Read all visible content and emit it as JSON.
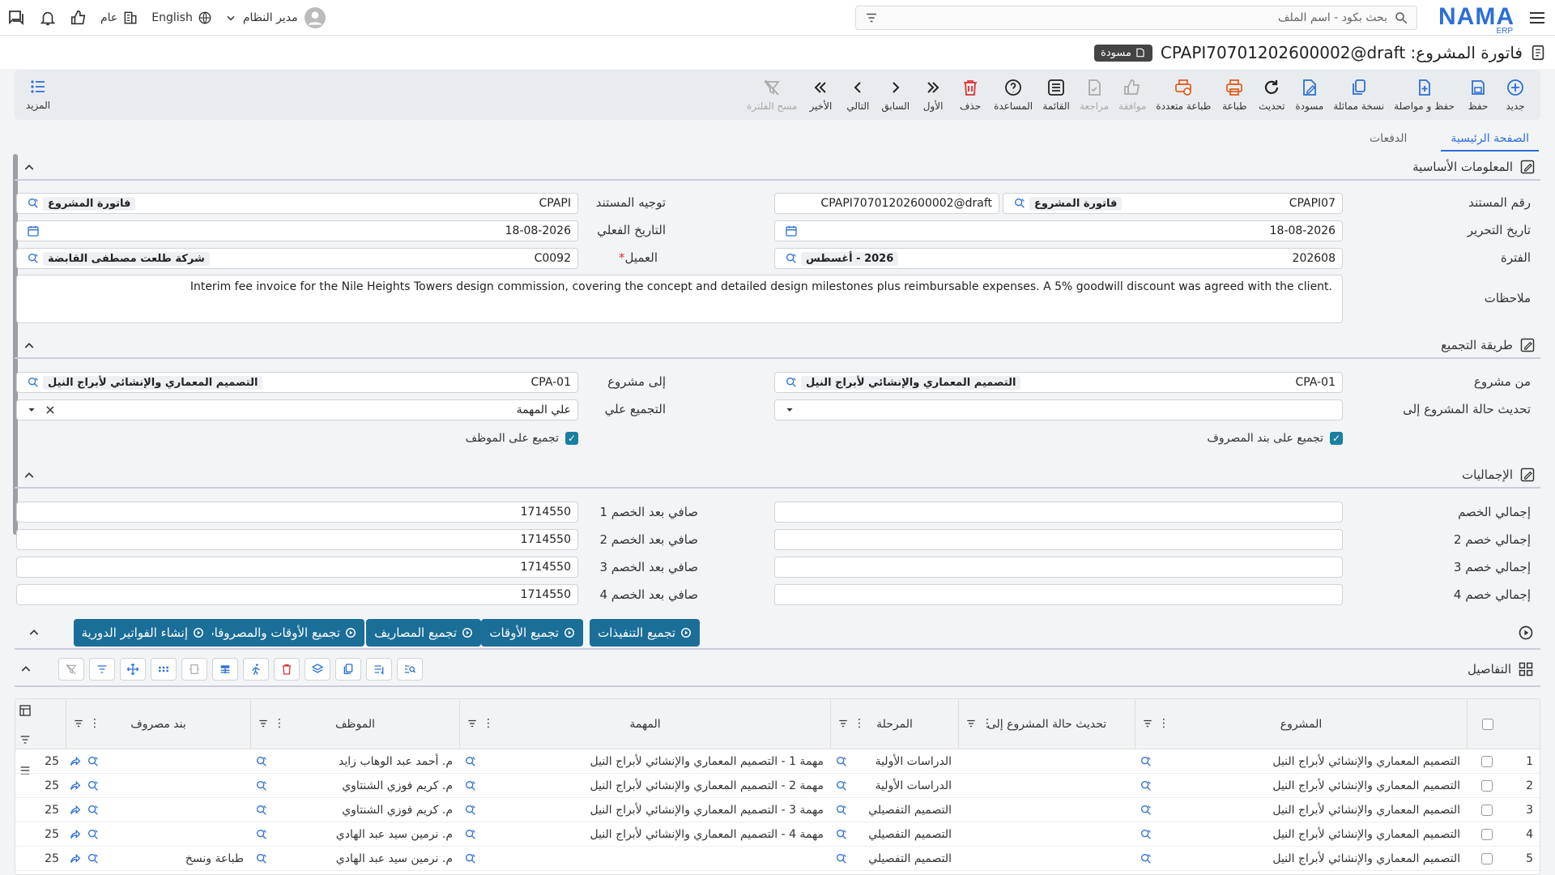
{
  "topbar": {
    "logo": "NAMA",
    "logo_sub": "ERP",
    "search_placeholder": "بحث بكود - اسم الملف",
    "user_name": "مدير النظام",
    "language": "English",
    "company": "عام"
  },
  "title": {
    "text": "فاتورة المشروع: CPAPI70701202600002@draft",
    "badge": "مسودة"
  },
  "toolbar": {
    "buttons": [
      {
        "label": "جديد",
        "icon": "plus-circle-icon"
      },
      {
        "label": "حفظ",
        "icon": "save-icon"
      },
      {
        "label": "حفظ و مواصلة",
        "icon": "save-continue-icon"
      },
      {
        "label": "نسخة مماثلة",
        "icon": "copy-icon"
      },
      {
        "label": "مسودة",
        "icon": "draft-icon"
      },
      {
        "label": "تحديث",
        "icon": "refresh-icon"
      },
      {
        "label": "طباعة",
        "icon": "print-icon"
      },
      {
        "label": "طباعة متعددة",
        "icon": "multi-print-icon"
      },
      {
        "label": "موافقة",
        "icon": "thumbs-up-icon"
      },
      {
        "label": "مراجعة",
        "icon": "review-icon"
      },
      {
        "label": "القائمة",
        "icon": "list-icon"
      },
      {
        "label": "المساعدة",
        "icon": "help-icon"
      },
      {
        "label": "حذف",
        "icon": "trash-icon"
      },
      {
        "label": "الأول",
        "icon": "first-icon"
      },
      {
        "label": "السابق",
        "icon": "prev-icon"
      },
      {
        "label": "التالي",
        "icon": "next-icon"
      },
      {
        "label": "الأخير",
        "icon": "last-icon"
      },
      {
        "label": "مسح الفلترة",
        "icon": "clear-filter-icon"
      }
    ],
    "more": "المزيد"
  },
  "tabs": [
    "الصفحة الرئيسية",
    "الدفعات"
  ],
  "basic_info": {
    "title": "المعلومات الأساسية",
    "doc_no_label": "رقم المستند",
    "doc_no_code": "CPAPI07",
    "doc_no_chip": "فاتورة المشروع",
    "doc_no_value": "CPAPI70701202600002@draft",
    "direction_label": "توجيه المستند",
    "direction_code": "CPAPI",
    "direction_chip": "فاتورة المشروع",
    "edit_date_label": "تاريخ التحرير",
    "edit_date": "18-08-2026",
    "actual_date_label": "التاريخ الفعلي",
    "actual_date": "18-08-2026",
    "period_label": "الفترة",
    "period_code": "202608",
    "period_chip": "2026 - أغسطس",
    "customer_label": "العميل",
    "customer_required": "*",
    "customer_code": "C0092",
    "customer_chip": "شركة طلعت مصطفى القابضة",
    "notes_label": "ملاحظات",
    "notes": "Interim fee invoice for the Nile Heights Towers design commission, covering the concept and detailed design milestones plus reimbursable expenses. A 5% goodwill discount was agreed with the client."
  },
  "grouping": {
    "title": "طريقة التجميع",
    "from_project_label": "من مشروع",
    "from_project_code": "CPA-01",
    "from_project_chip": "التصميم المعماري والإنشائي لأبراج النيل",
    "to_project_label": "إلى مشروع",
    "to_project_code": "CPA-01",
    "to_project_chip": "التصميم المعماري والإنشائي لأبراج النيل",
    "update_status_label": "تحديث حالة المشروع إلى",
    "group_on_label": "التجميع علي",
    "group_on_value": "علي المهمة",
    "chk_expense": "تجميع على بند المصروف",
    "chk_employee": "تجميع على الموظف"
  },
  "totals": {
    "title": "الإجماليات",
    "total_discount_label": "إجمالي الخصم",
    "total_discount2_label": "إجمالي خصم 2",
    "total_discount3_label": "إجمالي خصم 3",
    "total_discount4_label": "إجمالي خصم 4",
    "net1_label": "صافي بعد الخصم 1",
    "net2_label": "صافي بعد الخصم 2",
    "net3_label": "صافي بعد الخصم 3",
    "net4_label": "صافي بعد الخصم 4",
    "net1": "1714550",
    "net2": "1714550",
    "net3": "1714550",
    "net4": "1714550"
  },
  "actions": [
    "تجميع التنفيذات",
    "تجميع الأوقات",
    "تجميع المصاريف",
    "تجميع الأوقات والمصروفات",
    "إنشاء الفواتير الدورية"
  ],
  "details": {
    "title": "التفاصيل",
    "columns": [
      "المشروع",
      "تحديث حالة المشروع إلى",
      "المرحلة",
      "المهمة",
      "الموظف",
      "بند مصروف"
    ],
    "rows": [
      {
        "n": "1",
        "project": "التصميم المعماري والإنشائي لأبراج النيل",
        "status": "",
        "phase": "الدراسات الأولية",
        "task": "مهمة 1 - التصميم المعماري والإنشائي لأبراج النيل",
        "employee": "م. أحمد عبد الوهاب زايد",
        "expense": "",
        "qty": "25"
      },
      {
        "n": "2",
        "project": "التصميم المعماري والإنشائي لأبراج النيل",
        "status": "",
        "phase": "الدراسات الأولية",
        "task": "مهمة 2 - التصميم المعماري والإنشائي لأبراج النيل",
        "employee": "م. كريم فوزي الشنتاوي",
        "expense": "",
        "qty": "25"
      },
      {
        "n": "3",
        "project": "التصميم المعماري والإنشائي لأبراج النيل",
        "status": "",
        "phase": "التصميم التفصيلي",
        "task": "مهمة 3 - التصميم المعماري والإنشائي لأبراج النيل",
        "employee": "م. كريم فوزي الشنتاوي",
        "expense": "",
        "qty": "25"
      },
      {
        "n": "4",
        "project": "التصميم المعماري والإنشائي لأبراج النيل",
        "status": "",
        "phase": "التصميم التفصيلي",
        "task": "مهمة 4 - التصميم المعماري والإنشائي لأبراج النيل",
        "employee": "م. نرمين سيد عبد الهادي",
        "expense": "",
        "qty": "25"
      },
      {
        "n": "5",
        "project": "التصميم المعماري والإنشائي لأبراج النيل",
        "status": "",
        "phase": "التصميم التفصيلي",
        "task": "",
        "employee": "م. نرمين سيد عبد الهادي",
        "expense": "طباعة ونسخ",
        "qty": "25"
      }
    ]
  },
  "colors": {
    "accent": "#2d6fd6",
    "action": "#1a6e98",
    "danger": "#d33"
  }
}
